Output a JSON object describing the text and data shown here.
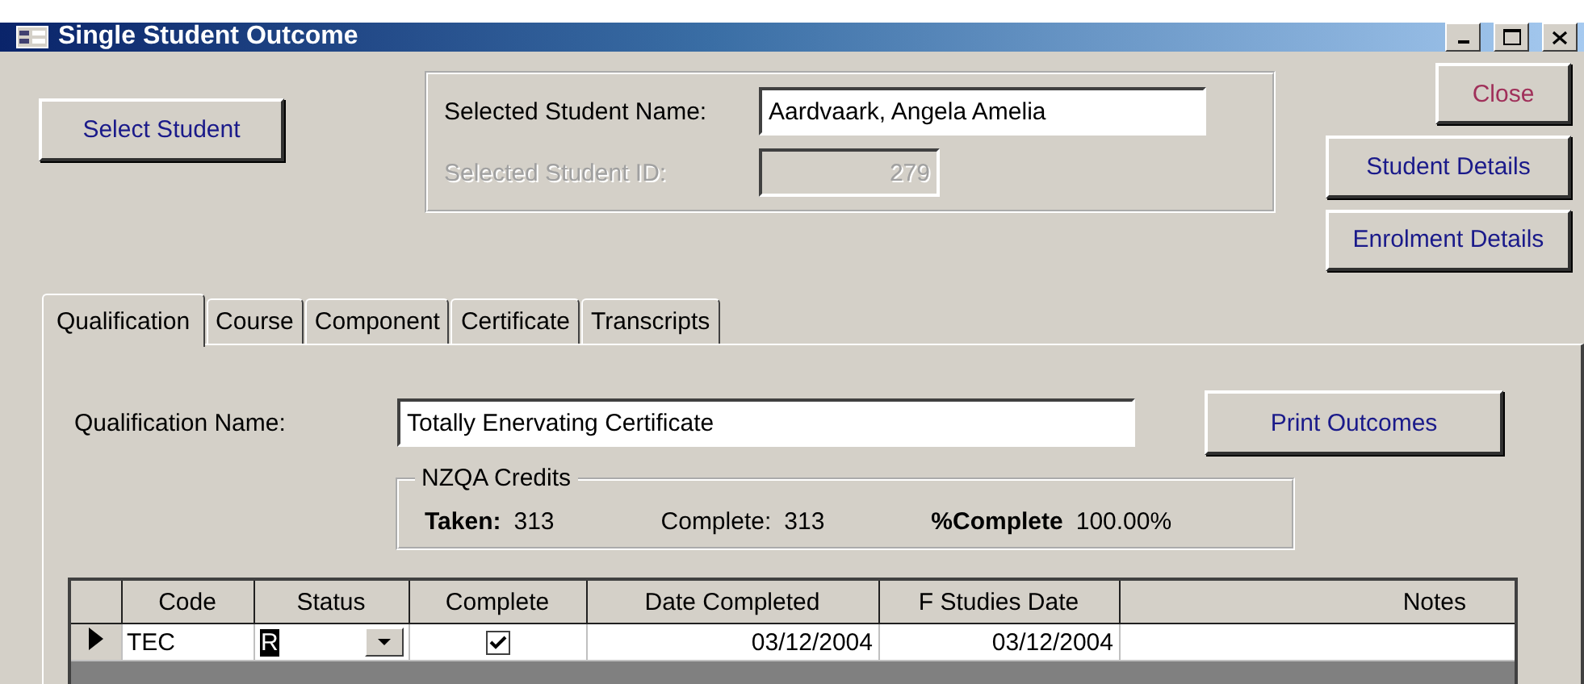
{
  "window": {
    "title": "Single Student Outcome"
  },
  "select_student_button": "Select Student",
  "student": {
    "name_label": "Selected Student Name:",
    "name_value": "Aardvaark, Angela Amelia",
    "id_label": "Selected Student ID:",
    "id_value": "279",
    "id_disabled": true
  },
  "side_buttons": [
    {
      "label": "Close",
      "kind": "close"
    },
    {
      "label": "Student Details",
      "kind": "normal"
    },
    {
      "label": "Enrolment Details",
      "kind": "normal"
    }
  ],
  "tabs": [
    {
      "label": "Qualification",
      "selected": true
    },
    {
      "label": "Course",
      "selected": false
    },
    {
      "label": "Component",
      "selected": false
    },
    {
      "label": "Certificate",
      "selected": false
    },
    {
      "label": "Transcripts",
      "selected": false
    }
  ],
  "qualification": {
    "label": "Qualification Name:",
    "value": "Totally Enervating Certificate"
  },
  "print_button": "Print Outcomes",
  "credits": {
    "legend": "NZQA Credits",
    "taken_label": "Taken:",
    "taken_value": "313",
    "complete_label": "Complete:",
    "complete_value": "313",
    "percent_label": "%Complete",
    "percent_value": "100.00%"
  },
  "table": {
    "columns": [
      "Code",
      "Status",
      "Complete",
      "Date Completed",
      "F Studies Date",
      "Notes"
    ],
    "rows": [
      {
        "current": true,
        "code": "TEC",
        "status": "R",
        "complete": true,
        "date_completed": "03/12/2004",
        "f_studies_date": "03/12/2004"
      }
    ]
  }
}
